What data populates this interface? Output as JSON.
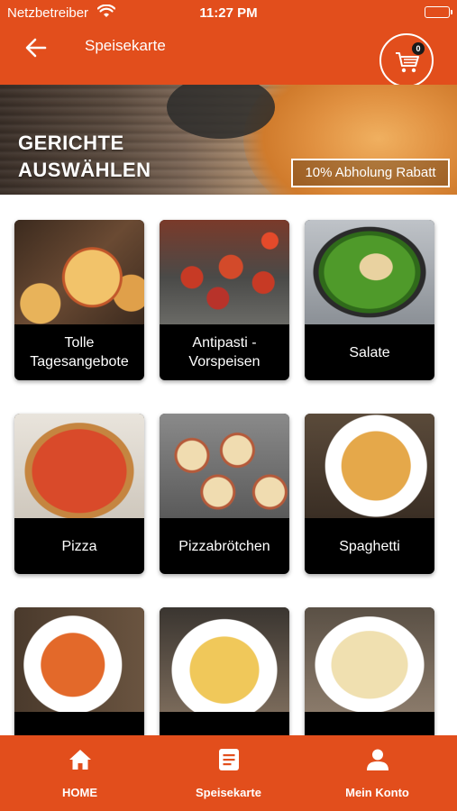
{
  "status_bar": {
    "carrier": "Netzbetreiber",
    "time": "11:27 PM"
  },
  "header": {
    "title": "Speisekarte",
    "cart_count": "0"
  },
  "banner": {
    "title_line1": "GERICHTE",
    "title_line2": "AUSWÄHLEN",
    "discount": "10% Abholung Rabatt"
  },
  "categories": [
    {
      "label": "Tolle Tagesangebote"
    },
    {
      "label": "Antipasti - Vorspeisen"
    },
    {
      "label": "Salate"
    },
    {
      "label": "Pizza"
    },
    {
      "label": "Pizzabrötchen"
    },
    {
      "label": "Spaghetti"
    },
    {
      "label": ""
    },
    {
      "label": ""
    },
    {
      "label": ""
    }
  ],
  "bottom_nav": {
    "items": [
      {
        "label": "HOME",
        "icon": "home-icon"
      },
      {
        "label": "Speisekarte",
        "icon": "menu-list-icon"
      },
      {
        "label": "Mein Konto",
        "icon": "user-icon"
      }
    ]
  },
  "colors": {
    "brand": "#e24e1c",
    "card_label_bg": "#000000",
    "text_on_brand": "#ffffff"
  }
}
